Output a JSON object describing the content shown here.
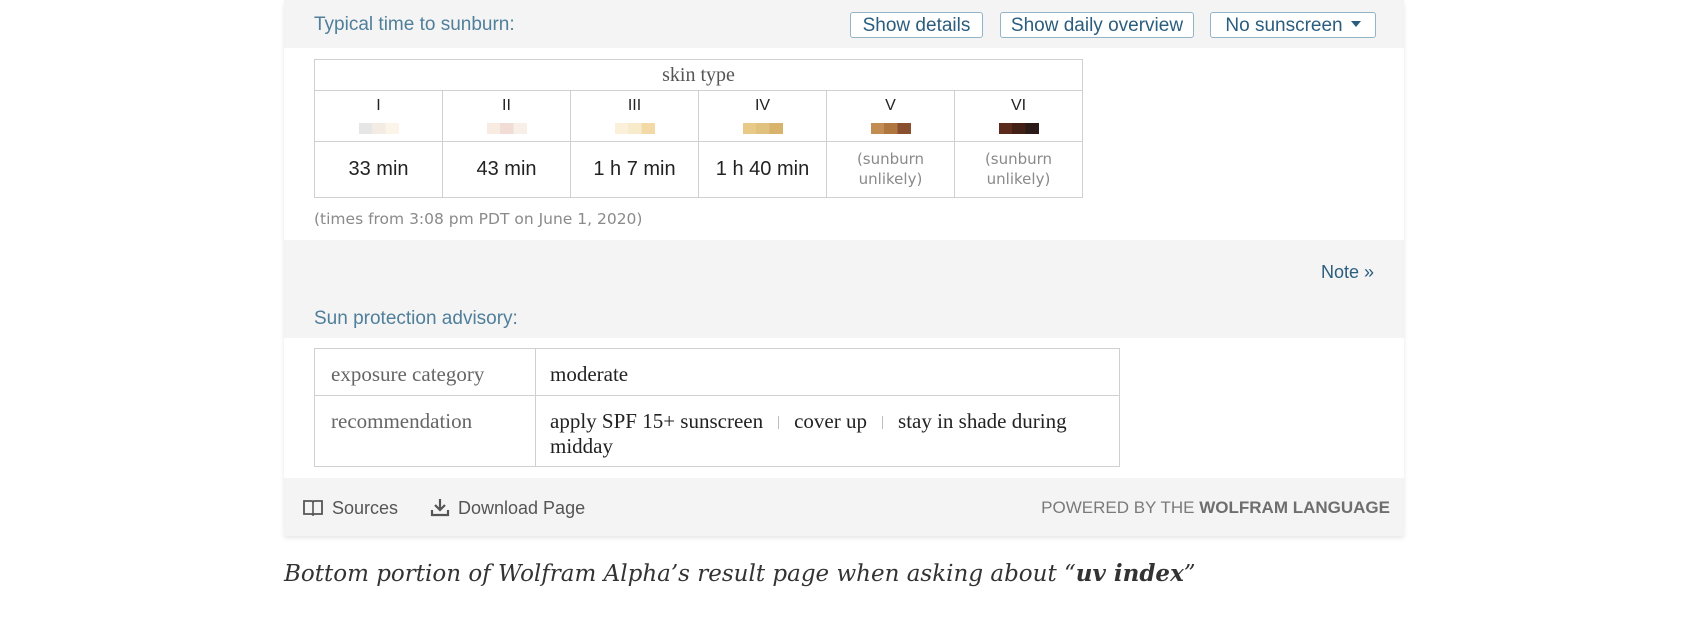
{
  "sunburn": {
    "title": "Typical time to sunburn:",
    "buttons": {
      "show_details": "Show details",
      "show_daily": "Show daily overview",
      "sunscreen_select": "No sunscreen"
    },
    "caption": "skin type",
    "types": [
      {
        "label": "I",
        "value": "33 min",
        "colors": [
          "#e6e6e6",
          "#f2ece4",
          "#faf5e8"
        ]
      },
      {
        "label": "II",
        "value": "43 min",
        "colors": [
          "#f7ebe2",
          "#f1ddd6",
          "#f8efe8"
        ]
      },
      {
        "label": "III",
        "value": "1 h 7 min",
        "colors": [
          "#fbf1da",
          "#f8ebcb",
          "#f3d9a5"
        ]
      },
      {
        "label": "IV",
        "value": "1 h 40 min",
        "colors": [
          "#e9c987",
          "#e0c17d",
          "#d7b36b"
        ]
      },
      {
        "label": "V",
        "value": "(sunburn unlikely)",
        "colors": [
          "#c18d52",
          "#b07640",
          "#8a4f2f"
        ]
      },
      {
        "label": "VI",
        "value": "(sunburn unlikely)",
        "colors": [
          "#5a2a1c",
          "#432015",
          "#2a1a18"
        ]
      }
    ],
    "footnote": "(times from 3:08 pm PDT on June 1, 2020)",
    "note_link": "Note »"
  },
  "advisory": {
    "title": "Sun protection advisory:",
    "rows": [
      {
        "key": "exposure category",
        "value": "moderate"
      },
      {
        "key": "recommendation",
        "items": [
          "apply SPF 15+ sunscreen",
          "cover up",
          "stay in shade during midday"
        ]
      }
    ],
    "separator": "|"
  },
  "footer": {
    "sources": "Sources",
    "download": "Download Page",
    "powered_prefix": "POWERED BY THE",
    "powered_brand": "WOLFRAM LANGUAGE"
  },
  "caption": {
    "prefix": "Bottom portion of Wolfram Alpha’s result page when asking about “",
    "query": "uv index",
    "suffix": "”"
  }
}
